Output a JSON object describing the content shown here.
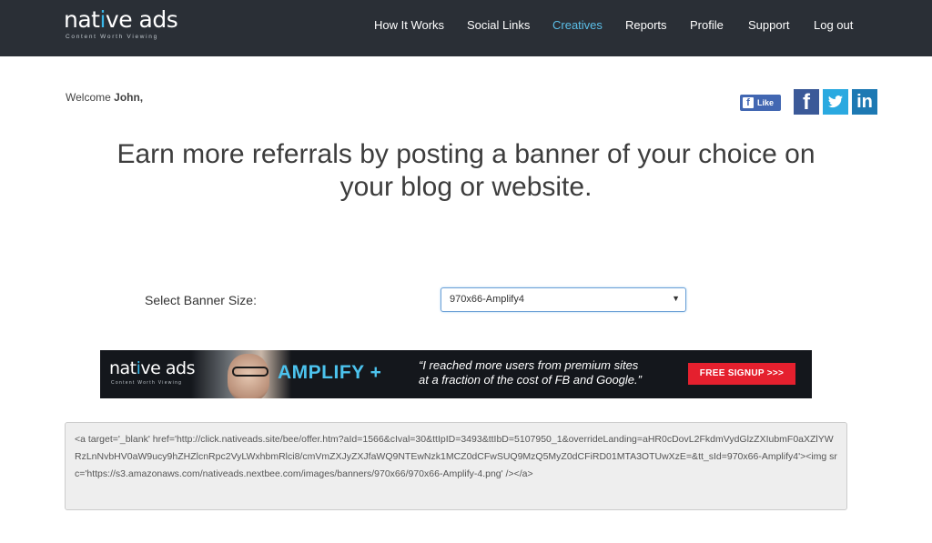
{
  "header": {
    "logo": {
      "text_main_a": "nat",
      "text_accent": "i",
      "text_main_b": "ve ads",
      "tagline": "Content Worth Viewing"
    },
    "nav": [
      {
        "label": "How It Works",
        "active": false
      },
      {
        "label": "Social Links",
        "active": false
      },
      {
        "label": "Creatives",
        "active": true
      },
      {
        "label": "Reports",
        "active": false
      },
      {
        "label": "Profile",
        "active": false
      },
      {
        "label": "Support",
        "active": false
      },
      {
        "label": "Log out",
        "active": false
      }
    ],
    "colors": {
      "bar": "#2a2f36",
      "active_link": "#5bbfe8"
    }
  },
  "welcome": {
    "prefix": "Welcome ",
    "name": "John,",
    "full": "Welcome John,"
  },
  "social": {
    "like_label": "Like",
    "icons": [
      "facebook-icon",
      "twitter-icon",
      "linkedin-icon"
    ]
  },
  "headline": "Earn more referrals by posting a banner of your choice on your blog or website.",
  "banner_select": {
    "label": "Select Banner Size:",
    "selected": "970x66-Amplify4"
  },
  "banner": {
    "logo_a": "nat",
    "logo_accent": "i",
    "logo_b": "ve ads",
    "logo_tagline": "Content Worth Viewing",
    "product": "AMPLIFY +",
    "quote_line1": "“I reached more users from premium sites",
    "quote_line2": "at a fraction of the cost of FB and Google.”",
    "cta": "FREE SIGNUP  >>>"
  },
  "embed_code": "<a target='_blank' href='http://click.nativeads.site/bee/offer.htm?aId=1566&cIval=30&ttIpID=3493&ttIbD=5107950_1&overrideLanding=aHR0cDovL2FkdmVydGlzZXIubmF0aXZlYWRzLnNvbHV0aW9ucy9hZHZlcnRpc2VyLWxhbmRlci8/cmVmZXJyZXJfaWQ9NTEwNzk1MCZ0dCFwSUQ9MzQ5MyZ0dCFiRD01MTA3OTUwXzE=&tt_sId=970x66-Amplify4'><img src='https://s3.amazonaws.com/nativeads.nextbee.com/images/banners/970x66/970x66-Amplify-4.png' /></a>"
}
